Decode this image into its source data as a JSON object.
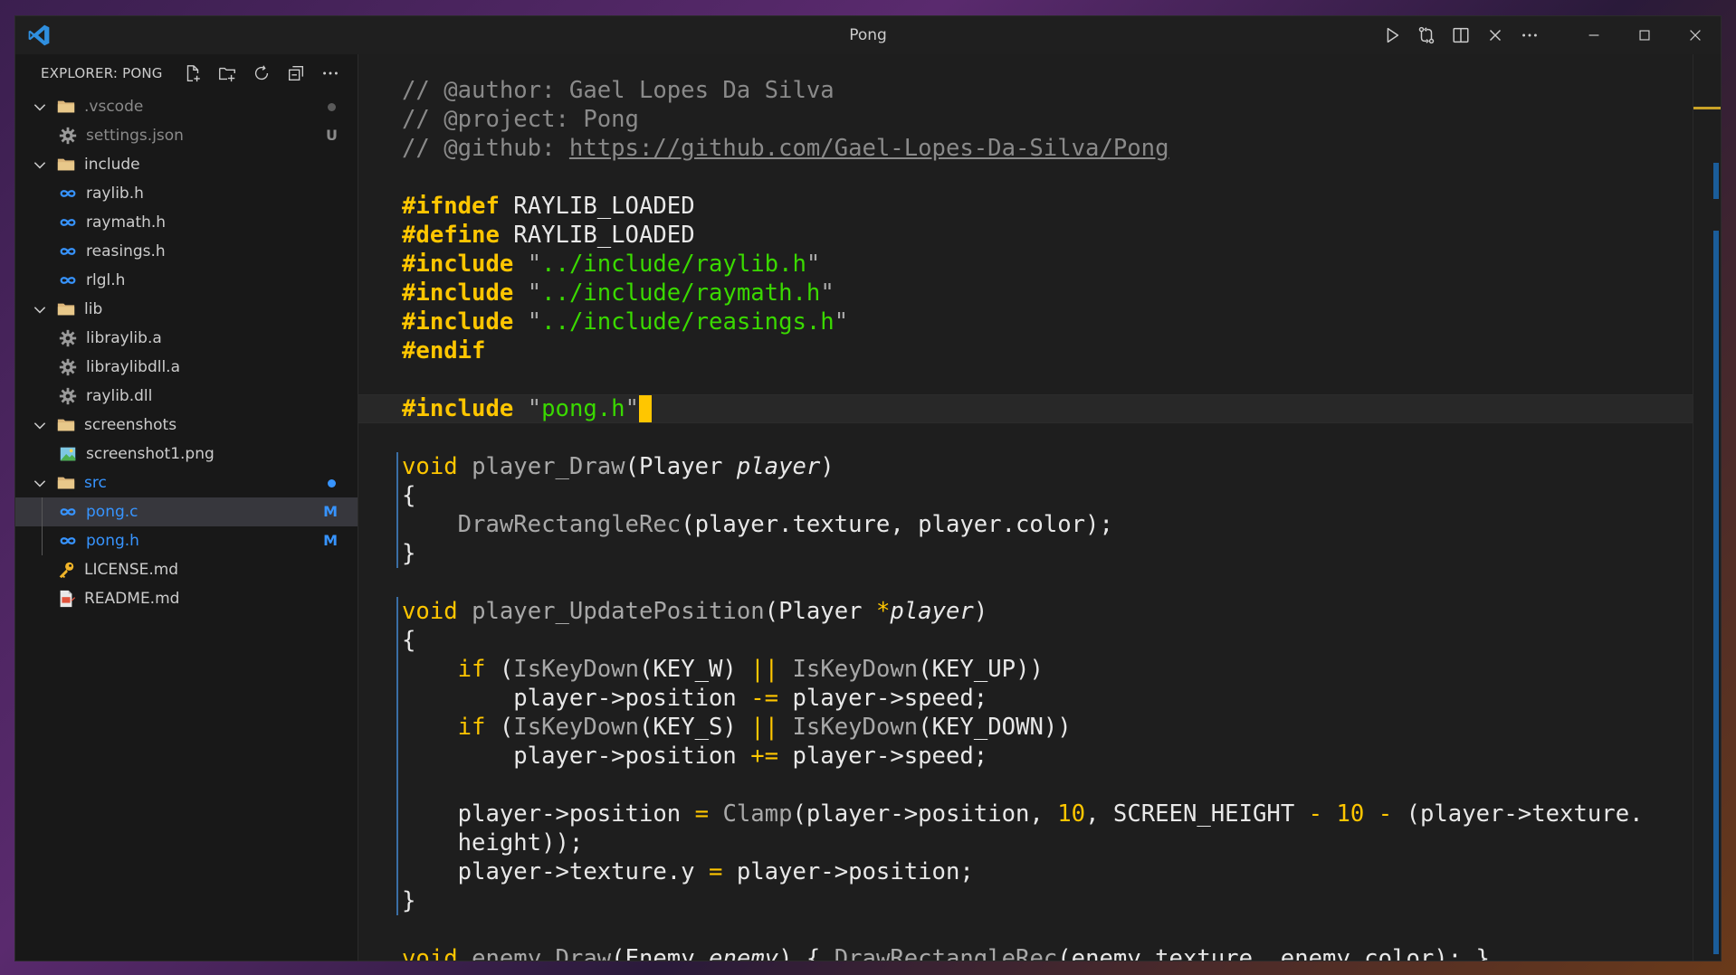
{
  "window": {
    "title": "Pong"
  },
  "colors": {
    "accent": "#007acc",
    "modified": "#3794ff",
    "untracked": "#8a8a8a",
    "folder": "#dcb67a",
    "c_file": "#3794ff",
    "keyword": "#ffc600",
    "string": "#3ad900",
    "comment": "#8a8a8a"
  },
  "explorer": {
    "title": "EXPLORER: PONG",
    "actions": [
      "new-file-icon",
      "new-folder-icon",
      "refresh-icon",
      "collapse-all-icon",
      "more-icon"
    ],
    "items": [
      {
        "label": ".vscode",
        "type": "folder",
        "depth": 0,
        "expanded": true,
        "dot": true
      },
      {
        "label": "settings.json",
        "type": "gear",
        "depth": 1,
        "badge": "U"
      },
      {
        "label": "include",
        "type": "folder",
        "depth": 0,
        "expanded": true
      },
      {
        "label": "raylib.h",
        "type": "c",
        "depth": 1
      },
      {
        "label": "raymath.h",
        "type": "c",
        "depth": 1
      },
      {
        "label": "reasings.h",
        "type": "c",
        "depth": 1
      },
      {
        "label": "rlgl.h",
        "type": "c",
        "depth": 1
      },
      {
        "label": "lib",
        "type": "folder",
        "depth": 0,
        "expanded": true
      },
      {
        "label": "libraylib.a",
        "type": "gear",
        "depth": 1
      },
      {
        "label": "libraylibdll.a",
        "type": "gear",
        "depth": 1
      },
      {
        "label": "raylib.dll",
        "type": "gear",
        "depth": 1
      },
      {
        "label": "screenshots",
        "type": "folder",
        "depth": 0,
        "expanded": true
      },
      {
        "label": "screenshot1.png",
        "type": "image",
        "depth": 1
      },
      {
        "label": "src",
        "type": "folder",
        "depth": 0,
        "expanded": true,
        "dot": true
      },
      {
        "label": "pong.c",
        "type": "c",
        "depth": 1,
        "badge": "M",
        "selected": true
      },
      {
        "label": "pong.h",
        "type": "c",
        "depth": 1,
        "badge": "M"
      },
      {
        "label": "LICENSE.md",
        "type": "key",
        "depth": 0
      },
      {
        "label": "README.md",
        "type": "doc",
        "depth": 0
      }
    ]
  },
  "editor": {
    "lines": [
      [
        [
          "cm",
          "// @author: Gael Lopes Da Silva"
        ]
      ],
      [
        [
          "cm",
          "// @project: Pong"
        ]
      ],
      [
        [
          "cm",
          "// @github: "
        ],
        [
          "link",
          "https://github.com/Gael-Lopes-Da-Silva/Pong"
        ]
      ],
      [],
      [
        [
          "pp",
          "#ifndef"
        ],
        [
          "t",
          " RAYLIB_LOADED"
        ]
      ],
      [
        [
          "pp",
          "#define"
        ],
        [
          "t",
          " RAYLIB_LOADED"
        ]
      ],
      [
        [
          "pp",
          "#include"
        ],
        [
          "t",
          " "
        ],
        [
          "strq",
          "\""
        ],
        [
          "str",
          "../include/raylib.h"
        ],
        [
          "strq",
          "\""
        ]
      ],
      [
        [
          "pp",
          "#include"
        ],
        [
          "t",
          " "
        ],
        [
          "strq",
          "\""
        ],
        [
          "str",
          "../include/raymath.h"
        ],
        [
          "strq",
          "\""
        ]
      ],
      [
        [
          "pp",
          "#include"
        ],
        [
          "t",
          " "
        ],
        [
          "strq",
          "\""
        ],
        [
          "str",
          "../include/reasings.h"
        ],
        [
          "strq",
          "\""
        ]
      ],
      [
        [
          "pp",
          "#endif"
        ]
      ],
      [],
      [
        [
          "pp",
          "#include"
        ],
        [
          "t",
          " "
        ],
        [
          "strq",
          "\""
        ],
        [
          "str",
          "pong.h"
        ],
        [
          "strq",
          "\""
        ],
        [
          "cursor",
          ""
        ]
      ],
      [],
      [
        [
          "kw",
          "void"
        ],
        [
          "t",
          " "
        ],
        [
          "call",
          "player_Draw"
        ],
        [
          "t",
          "(Player "
        ],
        [
          "param",
          "player"
        ],
        [
          "t",
          ")"
        ]
      ],
      [
        [
          "t",
          "{"
        ]
      ],
      [
        [
          "t",
          "    "
        ],
        [
          "call",
          "DrawRectangleRec"
        ],
        [
          "t",
          "(player.texture, player.color);"
        ]
      ],
      [
        [
          "t",
          "}"
        ]
      ],
      [],
      [
        [
          "kw",
          "void"
        ],
        [
          "t",
          " "
        ],
        [
          "call",
          "player_UpdatePosition"
        ],
        [
          "t",
          "(Player "
        ],
        [
          "op",
          "*"
        ],
        [
          "param",
          "player"
        ],
        [
          "t",
          ")"
        ]
      ],
      [
        [
          "t",
          "{"
        ]
      ],
      [
        [
          "t",
          "    "
        ],
        [
          "kw",
          "if"
        ],
        [
          "t",
          " ("
        ],
        [
          "call",
          "IsKeyDown"
        ],
        [
          "t",
          "(KEY_W) "
        ],
        [
          "op",
          "||"
        ],
        [
          "t",
          " "
        ],
        [
          "call",
          "IsKeyDown"
        ],
        [
          "t",
          "(KEY_UP))"
        ]
      ],
      [
        [
          "t",
          "        player->position "
        ],
        [
          "op",
          "-="
        ],
        [
          "t",
          " player->speed;"
        ]
      ],
      [
        [
          "t",
          "    "
        ],
        [
          "kw",
          "if"
        ],
        [
          "t",
          " ("
        ],
        [
          "call",
          "IsKeyDown"
        ],
        [
          "t",
          "(KEY_S) "
        ],
        [
          "op",
          "||"
        ],
        [
          "t",
          " "
        ],
        [
          "call",
          "IsKeyDown"
        ],
        [
          "t",
          "(KEY_DOWN))"
        ]
      ],
      [
        [
          "t",
          "        player->position "
        ],
        [
          "op",
          "+="
        ],
        [
          "t",
          " player->speed;"
        ]
      ],
      [],
      [
        [
          "t",
          "    player->position "
        ],
        [
          "op",
          "="
        ],
        [
          "t",
          " "
        ],
        [
          "call",
          "Clamp"
        ],
        [
          "t",
          "(player->position, "
        ],
        [
          "num",
          "10"
        ],
        [
          "t",
          ", SCREEN_HEIGHT "
        ],
        [
          "op",
          "-"
        ],
        [
          "t",
          " "
        ],
        [
          "num",
          "10"
        ],
        [
          "t",
          " "
        ],
        [
          "op",
          "-"
        ],
        [
          "t",
          " (player->texture."
        ]
      ],
      [
        [
          "t",
          "    height));"
        ]
      ],
      [
        [
          "t",
          "    player->texture.y "
        ],
        [
          "op",
          "="
        ],
        [
          "t",
          " player->position;"
        ]
      ],
      [
        [
          "t",
          "}"
        ]
      ],
      [],
      [
        [
          "kw",
          "void"
        ],
        [
          "t",
          " "
        ],
        [
          "call",
          "enemy_Draw"
        ],
        [
          "t",
          "(Enemy "
        ],
        [
          "param",
          "enemy"
        ],
        [
          "t",
          ") { "
        ],
        [
          "call",
          "DrawRectangleRec"
        ],
        [
          "t",
          "(enemy.texture, enemy.color); }"
        ]
      ]
    ]
  }
}
